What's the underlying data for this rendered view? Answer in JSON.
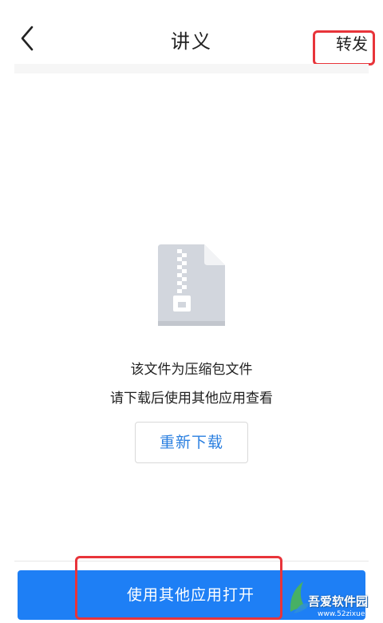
{
  "header": {
    "title": "讲义",
    "forward_label": "转发"
  },
  "content": {
    "message_line1": "该文件为压缩包文件",
    "message_line2": "请下载后使用其他应用查看",
    "redownload_label": "重新下载",
    "file_icon": "zip-file-icon"
  },
  "bottom": {
    "open_label": "使用其他应用打开"
  },
  "watermark": {
    "text": "吾爱软件园",
    "url": "www.52zixue.com"
  },
  "colors": {
    "accent": "#1e7ff5",
    "link": "#2a7fe0",
    "highlight": "#e8343a",
    "icon_gray": "#d2d6dd"
  }
}
